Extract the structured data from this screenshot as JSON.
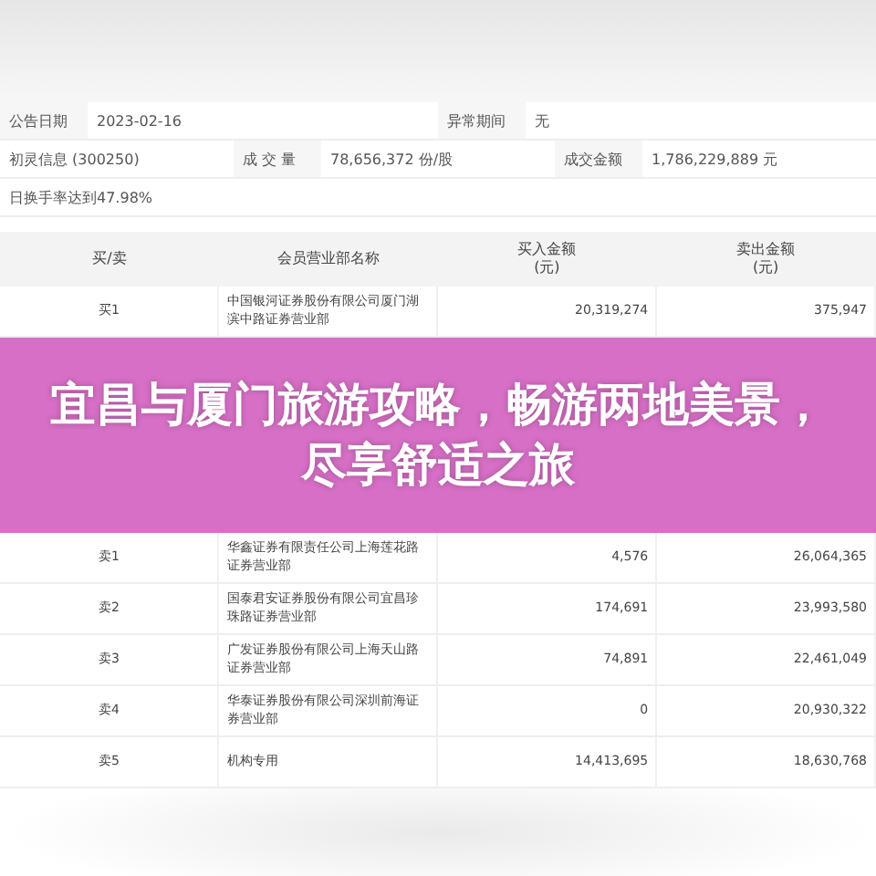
{
  "info": [
    [
      {
        "text": "公告日期",
        "kind": "label"
      },
      {
        "text": "2023-02-16",
        "kind": "value"
      },
      {
        "text": "异常期间",
        "kind": "label"
      },
      {
        "text": "无",
        "kind": "value"
      }
    ],
    [
      {
        "text": "初灵信息 (300250)",
        "kind": "value"
      },
      {
        "text": "成 交 量",
        "kind": "label"
      },
      {
        "text": "78,656,372 份/股",
        "kind": "value"
      },
      {
        "text": "成交金额",
        "kind": "label"
      },
      {
        "text": "1,786,229,889 元",
        "kind": "value"
      }
    ],
    [
      {
        "text": "日换手率达到47.98%",
        "kind": "value"
      }
    ]
  ],
  "table": {
    "columns": [
      "买/卖",
      "会员营业部名称",
      "买入金额\n(元)",
      "卖出金额\n(元)"
    ],
    "rows_above": [
      {
        "side": "买1",
        "name": "中国银河证券股份有限公司厦门湖滨中路证券营业部",
        "buy": "20,319,274",
        "sell": "375,947"
      }
    ],
    "rows_below": [
      {
        "side": "卖1",
        "name": "华鑫证券有限责任公司上海莲花路证券营业部",
        "buy": "4,576",
        "sell": "26,064,365"
      },
      {
        "side": "卖2",
        "name": "国泰君安证券股份有限公司宜昌珍珠路证券营业部",
        "buy": "174,691",
        "sell": "23,993,580"
      },
      {
        "side": "卖3",
        "name": "广发证券股份有限公司上海天山路证券营业部",
        "buy": "74,891",
        "sell": "22,461,049"
      },
      {
        "side": "卖4",
        "name": "华泰证券股份有限公司深圳前海证券营业部",
        "buy": "0",
        "sell": "20,930,322"
      },
      {
        "side": "卖5",
        "name": "机构专用",
        "buy": "14,413,695",
        "sell": "18,630,768"
      }
    ]
  },
  "banner": {
    "title": "宜昌与厦门旅游攻略，畅游两地美景，尽享舒适之旅"
  }
}
